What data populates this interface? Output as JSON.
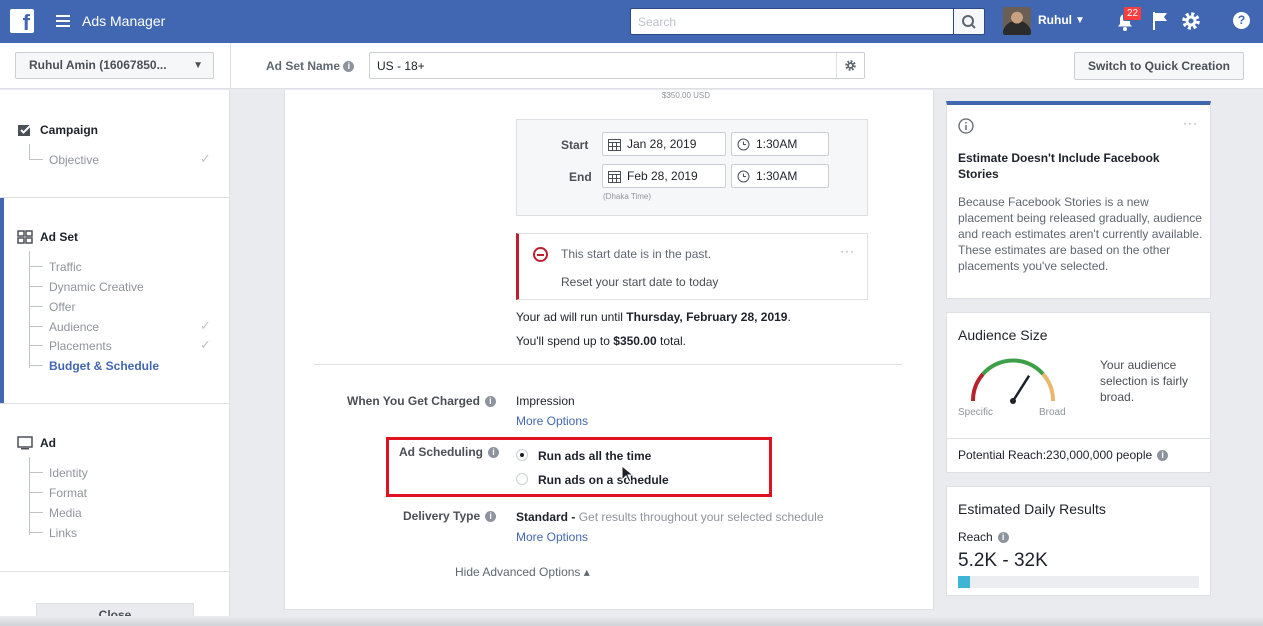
{
  "topbar": {
    "logo": "f",
    "app_name": "Ads Manager",
    "search_placeholder": "Search",
    "user_name": "Ruhul",
    "notifications_count": "22",
    "icons": [
      "hamburger-icon",
      "search-icon",
      "bell-icon",
      "flag-icon",
      "gear-icon",
      "help-icon"
    ]
  },
  "subbar": {
    "account": "Ruhul Amin (16067850...",
    "ad_set_name_label": "Ad Set Name",
    "ad_set_name_value": "US - 18+",
    "quick_creation_label": "Switch to Quick Creation"
  },
  "sidebar": {
    "campaign": {
      "label": "Campaign",
      "items": [
        {
          "label": "Objective",
          "done": true
        }
      ]
    },
    "ad_set": {
      "label": "Ad Set",
      "items": [
        {
          "label": "Traffic",
          "done": false
        },
        {
          "label": "Dynamic Creative",
          "done": false
        },
        {
          "label": "Offer",
          "done": false
        },
        {
          "label": "Audience",
          "done": true
        },
        {
          "label": "Placements",
          "done": true
        },
        {
          "label": "Budget & Schedule",
          "done": false,
          "active": true
        }
      ]
    },
    "ad": {
      "label": "Ad",
      "items": [
        {
          "label": "Identity"
        },
        {
          "label": "Format"
        },
        {
          "label": "Media"
        },
        {
          "label": "Links"
        }
      ]
    },
    "close_label": "Close"
  },
  "main": {
    "budget_total": "$350.00 USD",
    "start_label": "Start",
    "start_date": "Jan 28, 2019",
    "start_time": "1:30AM",
    "end_label": "End",
    "end_date": "Feb 28, 2019",
    "end_time": "1:30AM",
    "timezone": "(Dhaka Time)",
    "alert_text": "This start date is in the past.",
    "alert_link": "Reset your start date to today",
    "alert_more": "···",
    "run_until_prefix": "Your ad will run until ",
    "run_until_date": "Thursday, February 28, 2019",
    "run_until_suffix": ".",
    "spend_prefix": "You'll spend up to ",
    "spend_amount": "$350.00",
    "spend_suffix": " total.",
    "charged_label": "When You Get Charged",
    "charged_value": "Impression",
    "more_options": "More Options",
    "scheduling_label": "Ad Scheduling",
    "schedule_option_1": "Run ads all the time",
    "schedule_option_2": "Run ads on a schedule",
    "selected_option": 1,
    "delivery_label": "Delivery Type",
    "delivery_value": "Standard -",
    "delivery_desc": "Get results throughout your selected schedule",
    "hide_advanced": "Hide Advanced Options ▴"
  },
  "right": {
    "estimate": {
      "more": "···",
      "title": "Estimate Doesn't Include Facebook Stories",
      "body": "Because Facebook Stories is a new placement being released gradually, audience and reach estimates aren't currently available. These estimates are based on the other placements you've selected."
    },
    "audience": {
      "title": "Audience Size",
      "gauge_specific": "Specific",
      "gauge_broad": "Broad",
      "gauge_level": 0.68,
      "desc": "Your audience selection is fairly broad.",
      "potential_reach": "Potential Reach:230,000,000 people"
    },
    "daily": {
      "title": "Estimated Daily Results",
      "reach_label": "Reach",
      "reach_value": "5.2K - 32K",
      "reach_bar_fraction": 0.05
    }
  },
  "colors": {
    "brand": "#4267b2",
    "alert": "#be1e2d",
    "highlight_box": "#e1121f"
  }
}
